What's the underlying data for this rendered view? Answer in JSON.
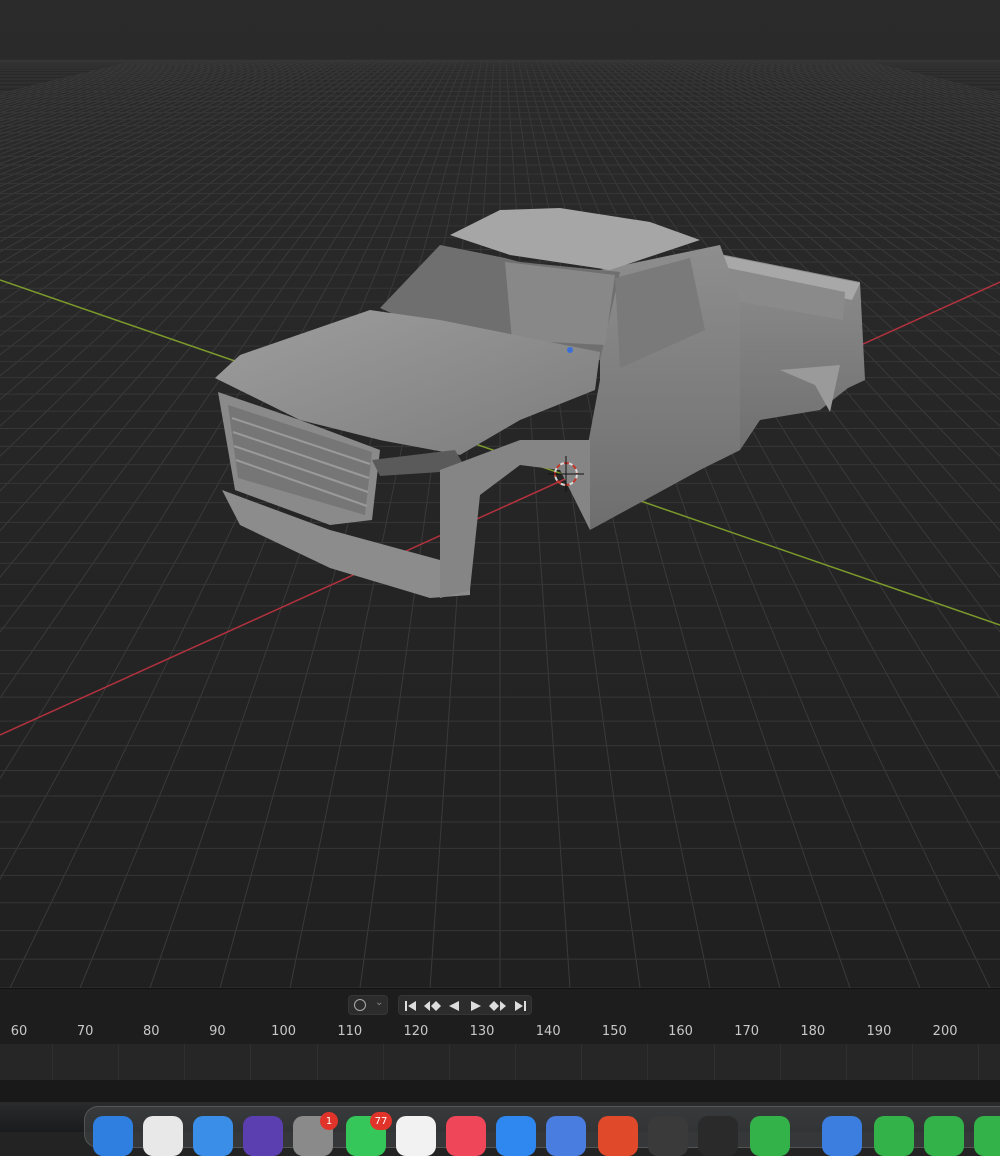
{
  "viewport": {
    "name": "3D Viewport",
    "object": "pickup truck body mesh",
    "axis_colors": {
      "x": "#b3323e",
      "y": "#7c9a2b"
    }
  },
  "timeline": {
    "playback_buttons": [
      "jump-start-icon",
      "prev-keyframe-icon",
      "play-reverse-icon",
      "play-icon",
      "next-keyframe-icon",
      "jump-end-icon"
    ],
    "frame_labels": [
      "60",
      "70",
      "80",
      "90",
      "100",
      "110",
      "120",
      "130",
      "140",
      "150",
      "160",
      "170",
      "180",
      "190",
      "200"
    ]
  },
  "dock": {
    "apps": [
      "finder-icon",
      "launchpad-icon",
      "safari-icon",
      "app-icon",
      "system-settings-icon",
      "messages-icon",
      "photos-icon",
      "music-icon",
      "xcode-icon",
      "preview-icon",
      "brave-icon",
      "app-icon",
      "terminal-icon",
      "numbers-icon",
      "downloads-icon",
      "numbers-icon",
      "numbers-icon",
      "numbers-icon"
    ],
    "badges": {
      "system_settings": "1",
      "messages": "77"
    }
  }
}
